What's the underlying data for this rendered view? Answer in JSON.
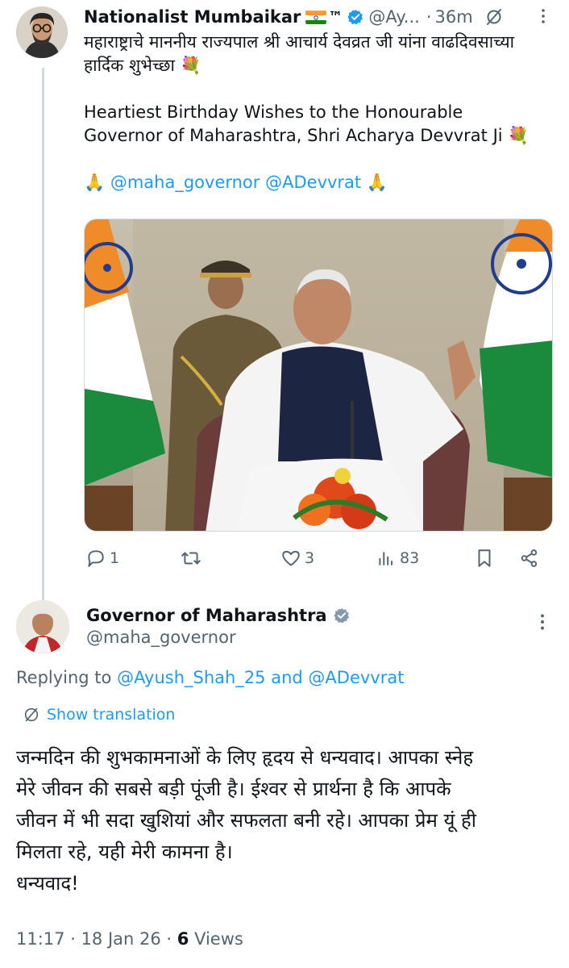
{
  "tweet1": {
    "author_name": "Nationalist Mumbaikar",
    "author_suffix": "™",
    "handle": "@Ay...",
    "time_sep": "·",
    "time": "36m",
    "text_line1": "महाराष्ट्राचे माननीय राज्यपाल श्री आचार्य देवव्रत जी यांना वाढदिवसाच्या",
    "text_line2": "हार्दिक शुभेच्छा 💐",
    "text_en_line1": "Heartiest Birthday Wishes to the Honourable",
    "text_en_line2": "Governor of Maharashtra, Shri Acharya Devvrat Ji 💐",
    "pray_left": "🙏 ",
    "mention1": "@maha_governor",
    "mention2": "@ADevvrat",
    "pray_right": " 🙏",
    "replies": "1",
    "reposts": "",
    "likes": "3",
    "views": "83"
  },
  "tweet2": {
    "author_name": "Governor of Maharashtra",
    "handle": "@maha_governor",
    "replying_prefix": "Replying to ",
    "reply_user1": "@Ayush_Shah_25",
    "reply_and": " and ",
    "reply_user2": "@ADevvrat",
    "show_translation": "Show translation",
    "body_line1": "जन्मदिन की शुभकामनाओं के लिए हृदय से धन्यवाद। आपका स्नेह",
    "body_line2": "मेरे जीवन की सबसे बड़ी पूंजी है। ईश्वर से प्रार्थना है कि आपके",
    "body_line3": "जीवन में भी सदा खुशियां और सफलता बनी रहे। आपका प्रेम यूं ही",
    "body_line4": "मिलता रहे, यही मेरी कामना है।",
    "body_line5": "धन्यवाद!",
    "time": "11:17",
    "sep1": " · ",
    "date": "18 Jan 26",
    "sep2": " · ",
    "views_count": "6",
    "views_label": " Views"
  },
  "colors": {
    "text": "#0f1419",
    "muted": "#536471",
    "link": "#1d9bf0",
    "verified": "#1d9bf0",
    "divider": "#cfd9de"
  },
  "icons": [
    "reply-icon",
    "repost-icon",
    "like-icon",
    "views-icon",
    "bookmark-icon",
    "share-icon",
    "more-icon",
    "grok-icon",
    "verified-badge-icon",
    "globe-icon"
  ]
}
